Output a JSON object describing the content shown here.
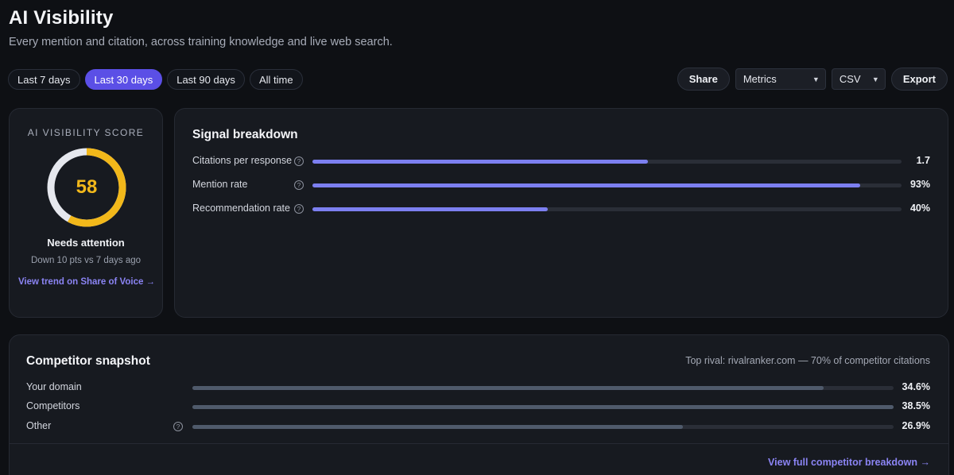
{
  "page": {
    "title": "AI Visibility",
    "subtitle": "Every mention and citation, across training knowledge and live web search."
  },
  "range_tabs": [
    {
      "label": "Last 7 days",
      "active": false
    },
    {
      "label": "Last 30 days",
      "active": true
    },
    {
      "label": "Last 90 days",
      "active": false
    },
    {
      "label": "All time",
      "active": false
    }
  ],
  "toolbar": {
    "share_label": "Share",
    "metrics_select": "Metrics",
    "format_select": "CSV",
    "export_label": "Export"
  },
  "score": {
    "label": "AI VISIBILITY SCORE",
    "value": 58,
    "max": 100,
    "status": "Needs attention",
    "delta": "Down 10 pts vs 7 days ago",
    "link": "View trend on Share of Voice →",
    "gauge_color": "#f2b81a",
    "track_color": "#e6e8ee"
  },
  "signal": {
    "title": "Signal breakdown",
    "accent": "#7c7ff0",
    "rows": [
      {
        "label": "Citations per response",
        "value": "1.7",
        "fill": 0.57
      },
      {
        "label": "Mention rate",
        "value": "93%",
        "fill": 0.93
      },
      {
        "label": "Recommendation rate",
        "value": "40%",
        "fill": 0.4
      }
    ]
  },
  "competitor": {
    "title": "Competitor snapshot",
    "rival_note": "Top rival: rivalranker.com — 70% of competitor citations",
    "bar_color": "#4f5a6b",
    "rows": [
      {
        "label": "Your domain",
        "value": "34.6%",
        "fill": 0.9,
        "help": false
      },
      {
        "label": "Competitors",
        "value": "38.5%",
        "fill": 1.0,
        "help": false
      },
      {
        "label": "Other",
        "value": "26.9%",
        "fill": 0.7,
        "help": true
      }
    ],
    "link": "View full competitor breakdown →"
  }
}
